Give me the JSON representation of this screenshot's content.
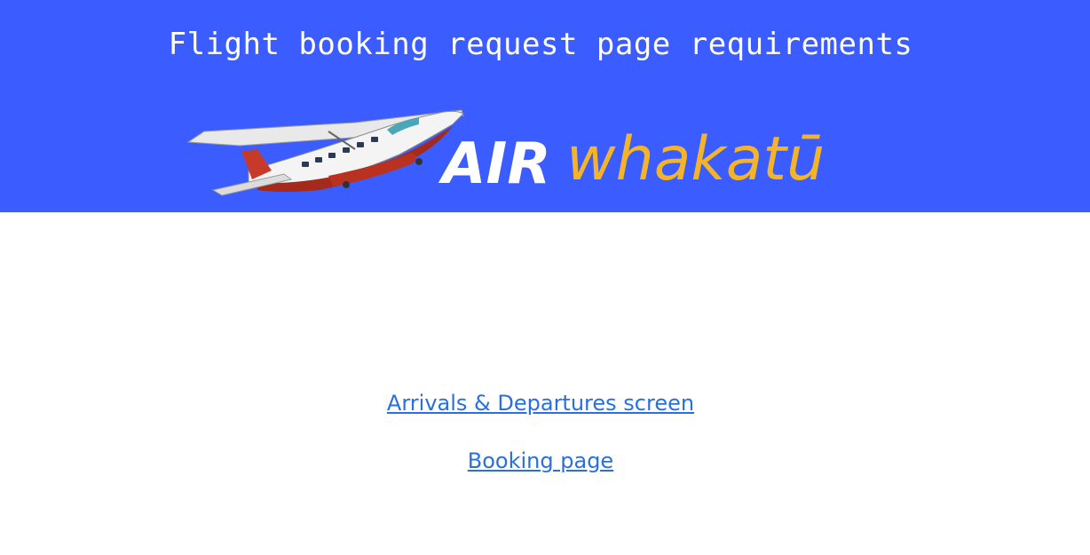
{
  "header": {
    "title": "Flight booking request page requirements",
    "background_color": "#3b5cff",
    "logo": {
      "text_air": "AIR",
      "text_brand": "whakatū",
      "air_color": "#ffffff",
      "brand_color": "#f4b42a",
      "icon": "airplane-icon"
    }
  },
  "links": [
    {
      "label": "Arrivals & Departures screen",
      "color": "#2a6fe0"
    },
    {
      "label": "Booking page",
      "color": "#2a6fe0"
    }
  ]
}
